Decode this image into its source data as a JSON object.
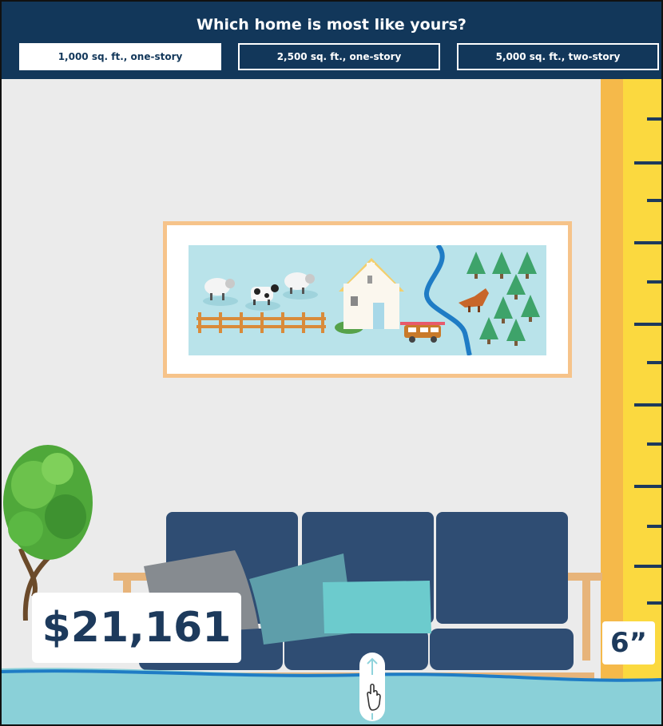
{
  "header": {
    "title": "Which home is most like yours?",
    "options": [
      {
        "label": "1,000 sq. ft., one-story",
        "selected": true
      },
      {
        "label": "2,500 sq. ft., one-story",
        "selected": false
      },
      {
        "label": "5,000 sq. ft., two-story",
        "selected": false
      }
    ]
  },
  "scene": {
    "price": "$21,161",
    "depth": "6”"
  },
  "colors": {
    "navy": "#12375a",
    "wall": "#ebebeb",
    "ruler_yellow": "#fbd93f",
    "ruler_orange": "#f5b94a",
    "water": "#8ad0d8",
    "sofa": "#2f4d73"
  }
}
